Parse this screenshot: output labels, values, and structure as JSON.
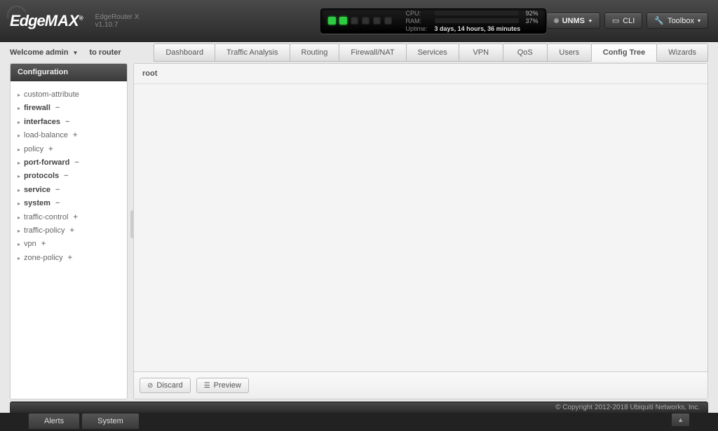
{
  "brand": {
    "name1": "Edge",
    "name2": "MAX",
    "subtitle": "EdgeRouter X v1.10.7"
  },
  "stats": {
    "cpu_label": "CPU:",
    "cpu_pct": 92,
    "cpu_text": "92%",
    "ram_label": "RAM:",
    "ram_pct": 37,
    "ram_text": "37%",
    "uptime_label": "Uptime:",
    "uptime_text": "3 days, 14 hours, 36 minutes"
  },
  "header_buttons": {
    "unms": "UNMS",
    "cli": "CLI",
    "toolbox": "Toolbox"
  },
  "welcome": {
    "text": "Welcome admin",
    "dest": "to router"
  },
  "nav_tabs": [
    "Dashboard",
    "Traffic Analysis",
    "Routing",
    "Firewall/NAT",
    "Services",
    "VPN",
    "QoS",
    "Users",
    "Config Tree",
    "Wizards"
  ],
  "active_tab_index": 8,
  "sidebar": {
    "title": "Configuration",
    "items": [
      {
        "label": "custom-attribute",
        "bold": false,
        "op": ""
      },
      {
        "label": "firewall",
        "bold": true,
        "op": "−"
      },
      {
        "label": "interfaces",
        "bold": true,
        "op": "−"
      },
      {
        "label": "load-balance",
        "bold": false,
        "op": "+"
      },
      {
        "label": "policy",
        "bold": false,
        "op": "+"
      },
      {
        "label": "port-forward",
        "bold": true,
        "op": "−"
      },
      {
        "label": "protocols",
        "bold": true,
        "op": "−"
      },
      {
        "label": "service",
        "bold": true,
        "op": "−"
      },
      {
        "label": "system",
        "bold": true,
        "op": "−"
      },
      {
        "label": "traffic-control",
        "bold": false,
        "op": "+"
      },
      {
        "label": "traffic-policy",
        "bold": false,
        "op": "+"
      },
      {
        "label": "vpn",
        "bold": false,
        "op": "+"
      },
      {
        "label": "zone-policy",
        "bold": false,
        "op": "+"
      }
    ]
  },
  "content": {
    "crumb": "root",
    "discard": "Discard",
    "preview": "Preview"
  },
  "footer": {
    "copyright": "© Copyright 2012-2018 Ubiquiti Networks, Inc."
  },
  "bottom_tabs": [
    "Alerts",
    "System"
  ]
}
